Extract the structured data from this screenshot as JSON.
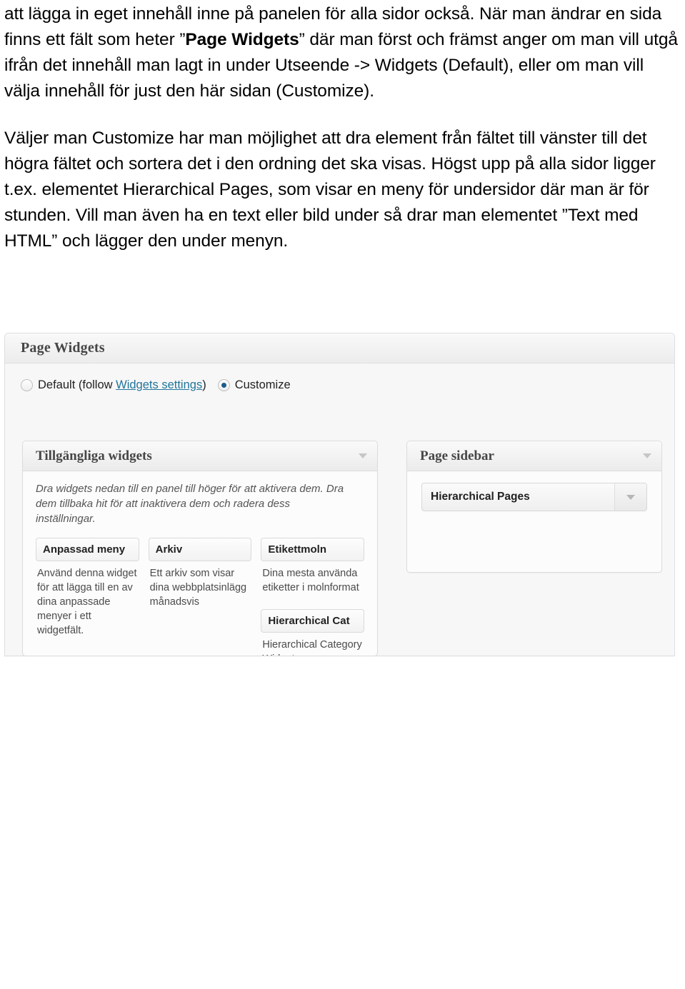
{
  "document": {
    "paragraphs": [
      {
        "id": "p1",
        "parts": [
          {
            "text": "att lägga in eget innehåll inne på panelen för alla sidor också. När man ändrar en sida finns ett fält som heter ”",
            "bold": false
          },
          {
            "text": "Page Widgets",
            "bold": true
          },
          {
            "text": "” där man först och främst anger om man vill utgå ifrån det innehåll man lagt in under Utseende -> Widgets (Default), eller om man vill välja innehåll för just den här sidan (Customize).",
            "bold": false
          }
        ]
      },
      {
        "id": "p2",
        "parts": [
          {
            "text": "Väljer man Customize har man möjlighet att dra element från fältet till vänster till det högra fältet och sortera det i den ordning det ska visas. Högst upp på alla sidor ligger t.ex. elementet Hierarchical Pages, som visar en meny för undersidor där man är för stunden. Vill man även ha en text eller bild under så drar man elementet ”Text med HTML” och lägger den under menyn.",
            "bold": false
          }
        ]
      }
    ]
  },
  "screenshot": {
    "metabox": {
      "title": "Page Widgets"
    },
    "mode_selector": {
      "options": [
        {
          "id": "default",
          "checked": false,
          "prefix": "Default (follow ",
          "link_text": "Widgets settings",
          "suffix": ")"
        },
        {
          "id": "customize",
          "checked": true,
          "prefix": "Customize",
          "link_text": "",
          "suffix": ""
        }
      ]
    },
    "available_widgets": {
      "title": "Tillgängliga widgets",
      "description": "Dra widgets nedan till en panel till höger för att aktivera dem. Dra dem tillbaka hit för att inaktivera dem och radera dess inställningar.",
      "columns": [
        {
          "widgets": [
            {
              "name": "Anpassad meny",
              "description": "Använd denna widget för att lägga till en av dina anpassade menyer i ett widgetfält."
            }
          ]
        },
        {
          "widgets": [
            {
              "name": "Arkiv",
              "description": "Ett arkiv som visar dina webbplatsinlägg månadsvis"
            }
          ]
        },
        {
          "widgets": [
            {
              "name": "Etikettmoln",
              "description": "Dina mesta använda etiketter i molnformat"
            },
            {
              "name": "Hierarchical Cat",
              "description": "Hierarchical Category Widget"
            }
          ]
        }
      ]
    },
    "page_sidebar": {
      "title": "Page sidebar",
      "widgets": [
        {
          "name": "Hierarchical Pages"
        }
      ]
    },
    "colors": {
      "link": "#21759b",
      "radio_dot": "#1a5c8a",
      "panel_border": "#dcdcdc",
      "header_text": "#464646"
    }
  }
}
